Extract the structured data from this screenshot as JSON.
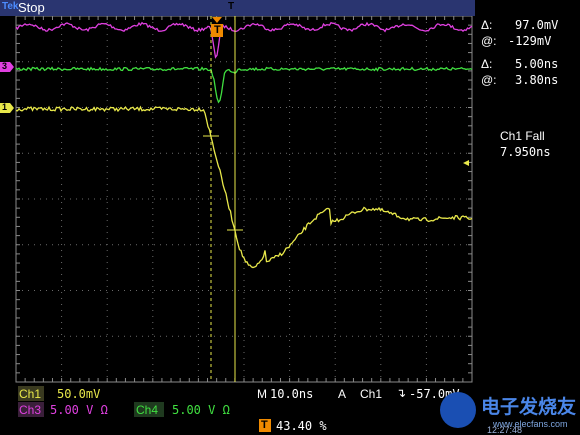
{
  "status": {
    "brand": "Tek",
    "run_state": "Stop"
  },
  "cursor_readout": {
    "v_delta": "97.0mV",
    "v_at": "-129mV",
    "t_delta": "5.00ns",
    "t_at": "3.80ns",
    "delta_symbol": "Δ:",
    "at_symbol": "@:"
  },
  "measurement": {
    "label": "Ch1 Fall",
    "value": "7.950ns"
  },
  "channels": {
    "ch1": {
      "label": "Ch1",
      "scale": "50.0mV",
      "color": "#e8e84a",
      "marker": "1"
    },
    "ch3": {
      "label": "Ch3",
      "scale": "5.00 V Ω",
      "color": "#e040e0",
      "marker": "3"
    },
    "ch4": {
      "label": "Ch4",
      "scale": "5.00 V Ω",
      "color": "#40e040"
    }
  },
  "timebase": {
    "label": "M",
    "value": "10.0ns"
  },
  "trigger": {
    "mode": "A",
    "source": "Ch1",
    "slope": "↴",
    "level": "-57.0mV",
    "position": "43.40 %",
    "marker": "T"
  },
  "watermark": {
    "text": "电子发烧友",
    "url": "www.elecfans.com",
    "time": "12:27:48"
  }
}
